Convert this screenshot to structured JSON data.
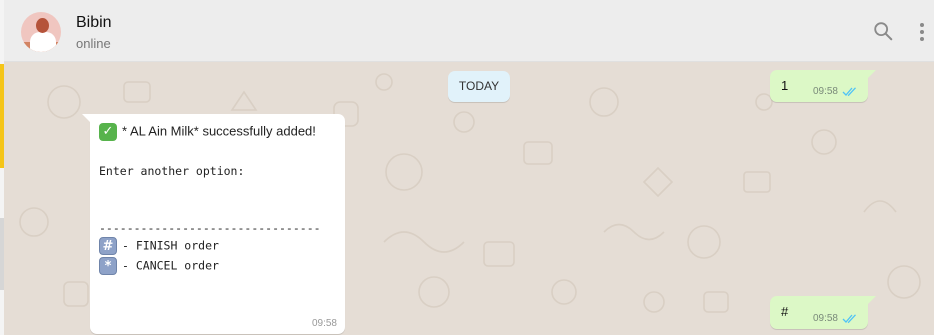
{
  "contact": {
    "name": "Bibin",
    "status": "online"
  },
  "header_icons": [
    "search-icon",
    "more-vertical-icon"
  ],
  "date_divider": "TODAY",
  "messages": [
    {
      "direction": "outgoing",
      "text": "1",
      "time": "09:58",
      "status": "read"
    },
    {
      "direction": "incoming",
      "lines": {
        "added": "* AL Ain Milk* successfully added!",
        "prompt": "Enter another option:",
        "divider": "--------------------------------",
        "finish": "- FINISH order",
        "cancel": "- CANCEL order"
      },
      "emojis": [
        "check-mark-button-emoji",
        "keycap-hash-emoji",
        "keycap-asterisk-emoji"
      ],
      "time": "09:58"
    },
    {
      "direction": "outgoing",
      "text": "#",
      "time": "09:58",
      "status": "read"
    }
  ],
  "colors": {
    "header_bg": "#ededed",
    "chat_bg": "#e5ddd5",
    "outgoing_bubble": "#dcf8c6",
    "incoming_bubble": "#ffffff",
    "date_pill": "#e1f2fa",
    "read_ticks": "#4fc3f7"
  }
}
